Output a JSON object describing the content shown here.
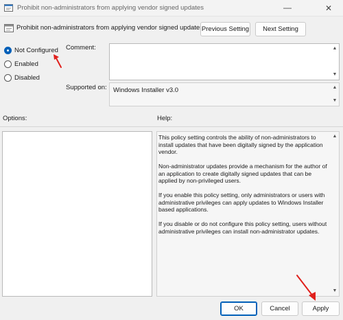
{
  "window": {
    "title": "Prohibit non-administrators from applying vendor signed updates",
    "minimize_glyph": "—",
    "close_glyph": "✕"
  },
  "header": {
    "title": "Prohibit non-administrators from applying vendor signed updates",
    "icon": "policy-setting-icon",
    "prev_button": "Previous Setting",
    "next_button": "Next Setting"
  },
  "state": {
    "options": [
      {
        "label": "Not Configured",
        "checked": true
      },
      {
        "label": "Enabled",
        "checked": false
      },
      {
        "label": "Disabled",
        "checked": false
      }
    ]
  },
  "comment": {
    "label": "Comment:",
    "value": ""
  },
  "supported": {
    "label": "Supported on:",
    "value": "Windows Installer v3.0"
  },
  "options_panel": {
    "label": "Options:"
  },
  "help_panel": {
    "label": "Help:",
    "paragraphs": [
      "This policy setting controls the ability of non-administrators to install updates that have been digitally signed by the application vendor.",
      "Non-administrator updates provide a mechanism for the author of an application to create digitally signed updates that can be applied by non-privileged users.",
      "If you enable this policy setting, only administrators or users with administrative privileges can apply updates to Windows Installer based applications.",
      "If you disable or do not configure this policy setting, users without administrative privileges can install non-administrator updates."
    ]
  },
  "footer": {
    "ok": "OK",
    "cancel": "Cancel",
    "apply": "Apply"
  },
  "colors": {
    "accent": "#005fb8",
    "annotation_arrow": "#e0201c"
  }
}
